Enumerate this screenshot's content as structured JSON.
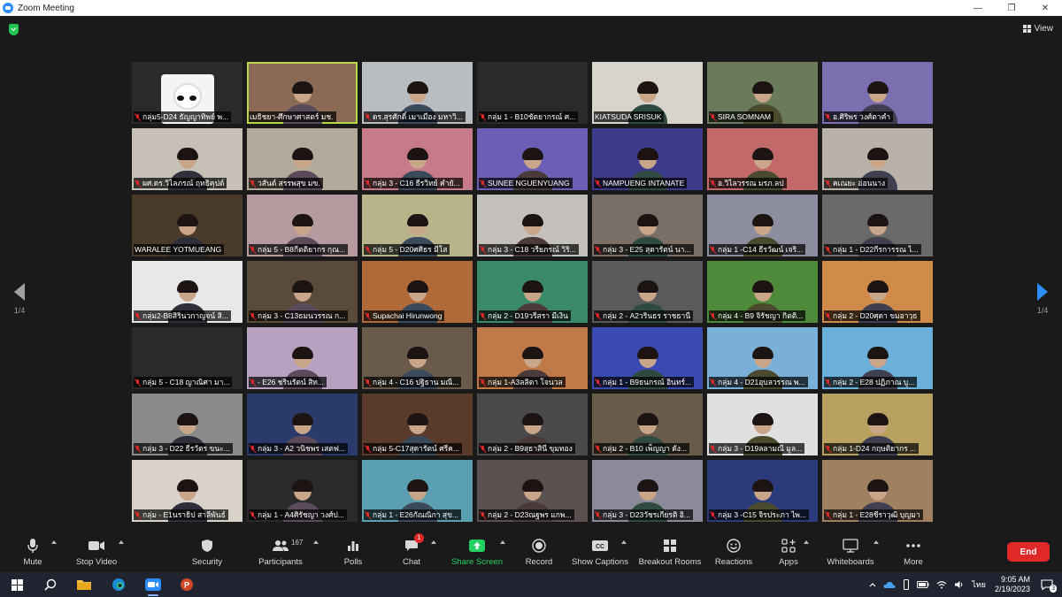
{
  "window": {
    "title": "Zoom Meeting",
    "buttons": [
      "—",
      "❐",
      "✕"
    ]
  },
  "meeting": {
    "view_label": "View",
    "page_indicator_left": "1/4",
    "page_indicator_right": "1/4",
    "tiles": [
      {
        "name": "กลุ่ม5-D24 ธัญญาทิพย์ พ...",
        "bg": "#2a2a2a",
        "avatar": "cartoon",
        "muted": true
      },
      {
        "name": "เมธิชยา-ศึกษาศาสตร์ มช.",
        "bg": "#8a6a55",
        "muted": false,
        "speaking": true
      },
      {
        "name": "ดร.สุรศักดิ์ เมาเมือง มหาวิ...",
        "bg": "#b9bcc0",
        "muted": true
      },
      {
        "name": "กลุ่ม 1 - B10ชัตยากรณ์ ศ...",
        "bg": "#2a2a2a",
        "muted": true,
        "novideo": true
      },
      {
        "name": "KIATSUDA SRISUK",
        "bg": "#d8d3cb",
        "muted": false
      },
      {
        "name": "SIRA SOMNAM",
        "bg": "#6a7a5a",
        "muted": true
      },
      {
        "name": "อ.ศิริพร วงศ์ตาคำ",
        "bg": "#7c6fb0",
        "muted": true
      },
      {
        "name": "ผศ.ดร.วิไลภรณ์ ฤทธิคุปต์",
        "bg": "#c7c0b6",
        "muted": true
      },
      {
        "name": "วสันต์ สรรพสุข มข.",
        "bg": "#b3aa9c",
        "muted": true
      },
      {
        "name": "กลุ่ม 3 - C16 ธีรวิทย์ คำยั...",
        "bg": "#c77a8a",
        "muted": true
      },
      {
        "name": "SUNEE NGUENYUANG",
        "bg": "#6a5fb4",
        "muted": true
      },
      {
        "name": "NAMPUENG INTANATE",
        "bg": "#3d3a8a",
        "muted": true
      },
      {
        "name": "อ.วิไลวรรณ มรภ.ลป",
        "bg": "#c26a6a",
        "muted": true
      },
      {
        "name": "คเณยะ อ่อนนาง",
        "bg": "#b8b2aa",
        "muted": true
      },
      {
        "name": "WARALEE YOTMUEANG",
        "bg": "#4a3a2a",
        "muted": false
      },
      {
        "name": "กลุ่ม 5 - B8กีตติยากร กุณ...",
        "bg": "#b59aa0",
        "muted": true
      },
      {
        "name": "กลุ่ม 5 - D20ศศิธร มีโส",
        "bg": "#b8b48a",
        "muted": true
      },
      {
        "name": "กลุ่ม 3 - C18 วรียภรณ์ วิริ...",
        "bg": "#c4c0bb",
        "muted": true
      },
      {
        "name": "กลุ่ม 3 - E25 สุดารัตน์ นา...",
        "bg": "#7a6f66",
        "muted": true
      },
      {
        "name": "กลุ่ม 1 -C14 ธีรวัฒน์ เจริ...",
        "bg": "#8c8ea0",
        "muted": true
      },
      {
        "name": "กลุ่ม 1 - D22กีรการรณ ไ...",
        "bg": "#6a6a6a",
        "muted": true
      },
      {
        "name": "กลุ่ม2-B8สิรินวกาญจน์ สิ...",
        "bg": "#e8e8e8",
        "muted": true
      },
      {
        "name": "กลุ่ม 3 - C13ธมนวรรณ ก...",
        "bg": "#5a4a3a",
        "muted": true
      },
      {
        "name": "Supachai Hirunwong",
        "bg": "#b06a3a",
        "muted": true
      },
      {
        "name": "กลุ่ม 2 - D19วรีสรา มีเงิน",
        "bg": "#3a8a6a",
        "muted": true
      },
      {
        "name": "กลุ่ม 2 - A2วรินธร ราชธานี",
        "bg": "#5a5a5a",
        "muted": true
      },
      {
        "name": "กลุ่ม 4 - B9 จิรัชญา กิตติ...",
        "bg": "#4f8a3a",
        "muted": true
      },
      {
        "name": "กลุ่ม 2 - D20ศุดา ขมอาวุธ",
        "bg": "#d08a4a",
        "muted": true
      },
      {
        "name": "กลุ่ม 5 - C18 ญาณิศา มา...",
        "bg": "#2a2a2a",
        "muted": true,
        "novideo": true
      },
      {
        "name": "- E26 ชรินรัตน์ สิท...",
        "bg": "#b8a0c0",
        "muted": true
      },
      {
        "name": "กลุ่ม 4 - C16 ปฐิธาน มณี...",
        "bg": "#6a5a4a",
        "muted": true
      },
      {
        "name": "กลุ่ม 1-A3ลลิตา โจนวล",
        "bg": "#c07a4a",
        "muted": true
      },
      {
        "name": "กลุ่ม 1 - B9ธนกรณ์ อินทร์...",
        "bg": "#3a4ab0",
        "muted": true
      },
      {
        "name": "กลุ่ม 4 - D21อุบลวรรณ พ...",
        "bg": "#7ab0d8",
        "muted": true
      },
      {
        "name": "กลุ่ม 2 - E28 ปฏิภาณ บู...",
        "bg": "#6ab0d8",
        "muted": true
      },
      {
        "name": "กลุ่ม 3 - D22 ธีรวัตร ขนะ...",
        "bg": "#8a8a8a",
        "muted": true
      },
      {
        "name": "กลุ่ม 3 - A2 วนิชพร เสตฟ...",
        "bg": "#2a3a6a",
        "muted": true
      },
      {
        "name": "กลุ่ม 5-C17สุดารัตน์ ศรีค...",
        "bg": "#5a3a2a",
        "muted": true
      },
      {
        "name": "กลุ่ม 2 - B9สุธาสินี ขุมทอง",
        "bg": "#4a4a4a",
        "muted": true
      },
      {
        "name": "กลุ่ม 2 - B10 เพ็ญญา ดัง...",
        "bg": "#6a5a4a",
        "muted": true
      },
      {
        "name": "กลุ่ม 3 - D19ลลามณี มูล...",
        "bg": "#e0e0e0",
        "muted": true
      },
      {
        "name": "กลุ่ม 1-D24 กฤษติยากร ...",
        "bg": "#b8a060",
        "muted": true
      },
      {
        "name": "กลุ่ม - E1นราธิป สาลีพันธ์",
        "bg": "#d8d2c8",
        "muted": true
      },
      {
        "name": "กลุ่ม 1 - A4ศิรัชญา วงศ์ป...",
        "bg": "#2a2a2a",
        "muted": true
      },
      {
        "name": "กลุ่ม 1 - E26กัณณิกา สุข...",
        "bg": "#5aa0b0",
        "muted": true
      },
      {
        "name": "กลุ่ม 2 - D23ณฐพร แกพ...",
        "bg": "#5a5050",
        "muted": true
      },
      {
        "name": "กลุ่ม 3 - D23วัชรเกียรติ อิ...",
        "bg": "#8a8a9a",
        "muted": true
      },
      {
        "name": "กลุ่ม 3 -C15 จิรประภา ไพ...",
        "bg": "#2a3a7a",
        "muted": true
      },
      {
        "name": "กลุ่ม 1 - E28ชีราวุฒิ บุญมา",
        "bg": "#a08060",
        "muted": true
      }
    ]
  },
  "toolbar": {
    "mute": "Mute",
    "stop_video": "Stop Video",
    "security": "Security",
    "participants": "Participants",
    "participants_count": "167",
    "polls": "Polls",
    "chat": "Chat",
    "chat_badge": "1",
    "share_screen": "Share Screen",
    "record": "Record",
    "show_captions": "Show Captions",
    "breakout_rooms": "Breakout Rooms",
    "reactions": "Reactions",
    "apps": "Apps",
    "whiteboards": "Whiteboards",
    "more": "More",
    "end": "End"
  },
  "taskbar": {
    "language": "ไทย",
    "time": "9:05 AM",
    "date": "2/19/2023",
    "notification_count": "3"
  }
}
